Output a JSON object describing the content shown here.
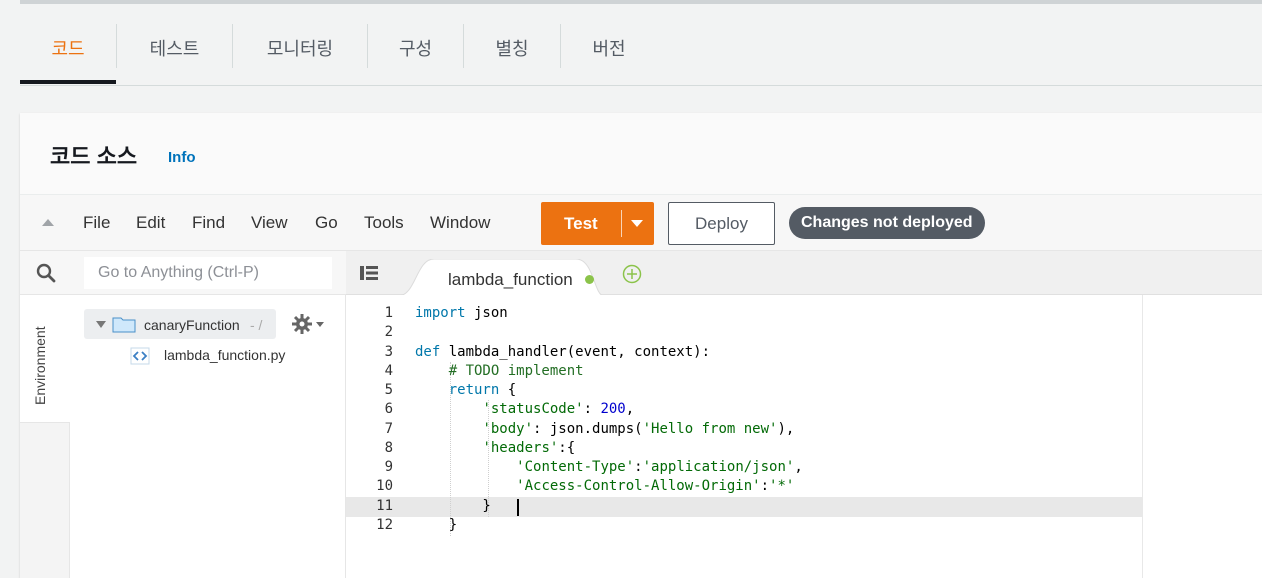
{
  "tabs": [
    {
      "label": "코드",
      "active": true
    },
    {
      "label": "테스트",
      "active": false
    },
    {
      "label": "모니터링",
      "active": false
    },
    {
      "label": "구성",
      "active": false
    },
    {
      "label": "별칭",
      "active": false
    },
    {
      "label": "버전",
      "active": false
    }
  ],
  "panel": {
    "title": "코드 소스",
    "info_link": "Info"
  },
  "menu": [
    "File",
    "Edit",
    "Find",
    "View",
    "Go",
    "Tools",
    "Window"
  ],
  "toolbar": {
    "test_label": "Test",
    "deploy_label": "Deploy",
    "status_badge": "Changes not deployed"
  },
  "search": {
    "placeholder": "Go to Anything (Ctrl-P)"
  },
  "sidebar": {
    "environment_label": "Environment"
  },
  "file_tree": {
    "folder": "canaryFunction",
    "folder_suffix": "- /",
    "file": "lambda_function.py"
  },
  "editor": {
    "tab_label": "lambda_function",
    "unsaved": true,
    "active_line": 11,
    "line_numbers": [
      "1",
      "2",
      "3",
      "4",
      "5",
      "6",
      "7",
      "8",
      "9",
      "10",
      "11",
      "12"
    ],
    "lines": [
      "import json",
      "",
      "def lambda_handler(event, context):",
      "    # TODO implement",
      "    return {",
      "        'statusCode': 200,",
      "        'body': json.dumps('Hello from new'),",
      "        'headers':{",
      "            'Content-Type':'application/json',",
      "            'Access-Control-Allow-Origin':'*'",
      "        }",
      "    }"
    ]
  },
  "colors": {
    "accent": "#ec7211",
    "badge": "#545b64",
    "link": "#0073bb",
    "unsaved_dot": "#8bc34a"
  },
  "icons": [
    "collapse-arrow-icon",
    "search-icon",
    "folder-icon",
    "gear-icon",
    "python-file-icon",
    "tab-list-icon",
    "add-tab-icon",
    "caret-down-icon"
  ]
}
